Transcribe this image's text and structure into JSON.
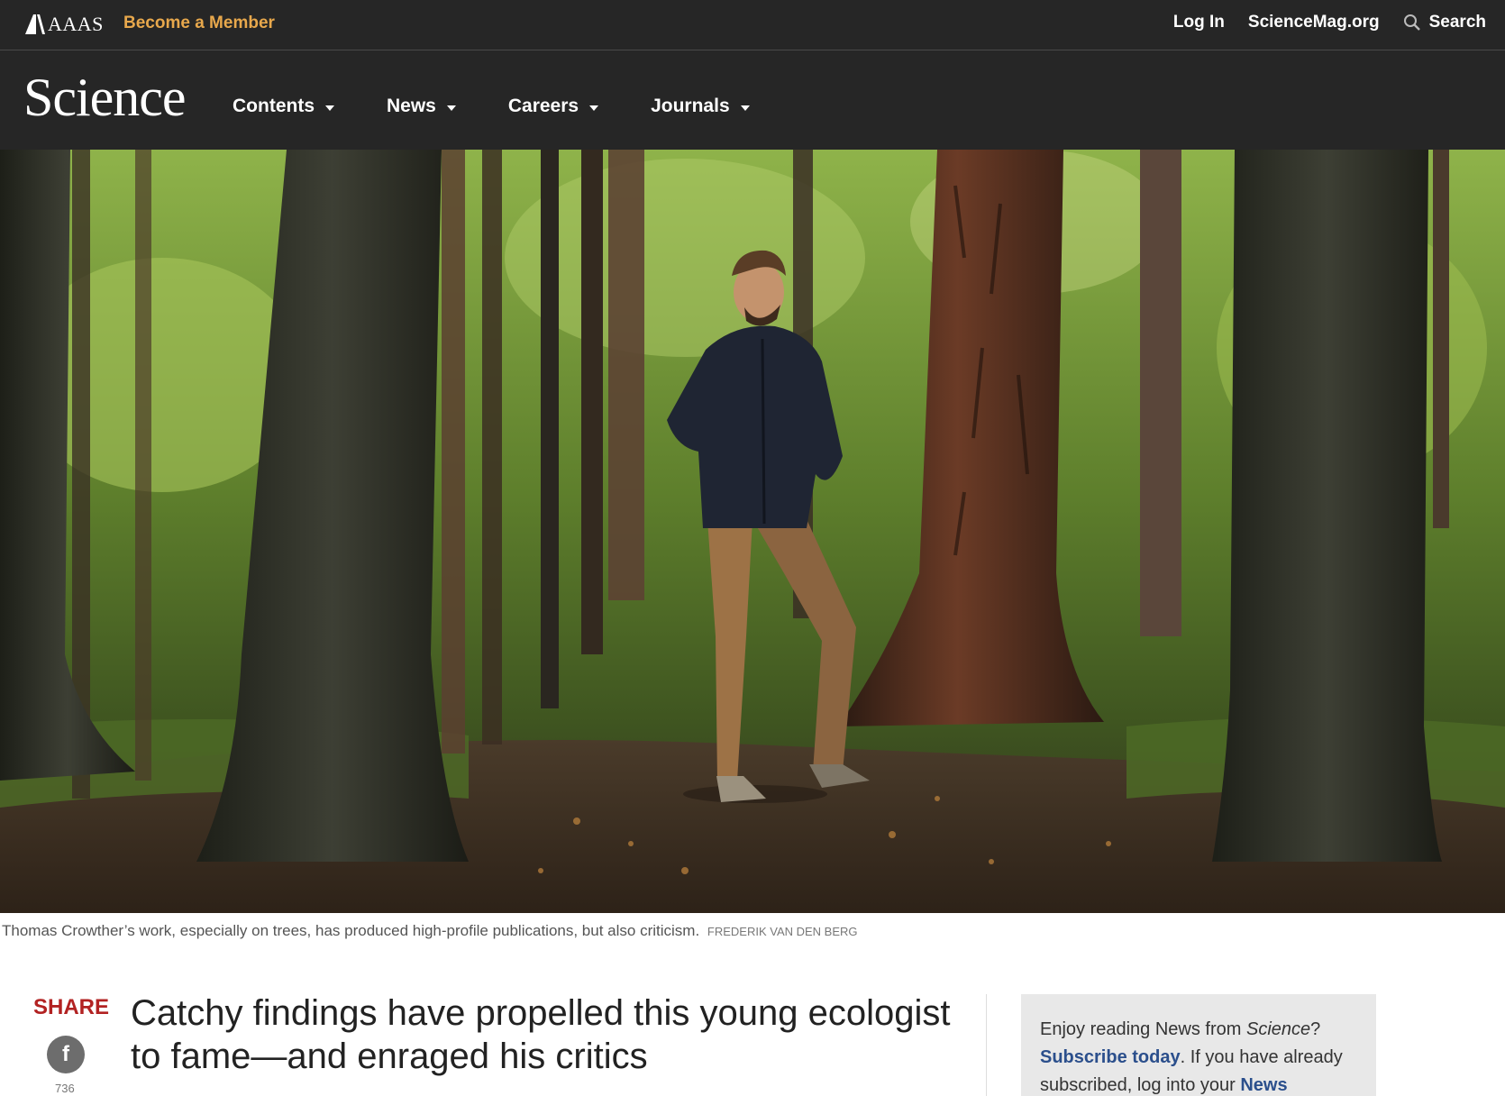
{
  "topbar": {
    "brand": "AAAS",
    "become_member": "Become a Member",
    "login": "Log In",
    "sciencemag": "ScienceMag.org",
    "search": "Search"
  },
  "nav": {
    "logo": "Science",
    "items": [
      {
        "label": "Contents"
      },
      {
        "label": "News"
      },
      {
        "label": "Careers"
      },
      {
        "label": "Journals"
      }
    ]
  },
  "photo": {
    "caption": "Thomas Crowther’s work, especially on trees, has produced high-profile publications, but also criticism.",
    "credit": "FREDERIK VAN DEN BERG"
  },
  "share": {
    "label": "SHARE",
    "facebook_count": "736"
  },
  "article": {
    "headline": "Catchy findings have propelled this young ecologist to fame—and enraged his critics"
  },
  "promo": {
    "line1_prefix": "Enjoy reading News from ",
    "line1_em": "Science",
    "line1_suffix": "?",
    "subscribe": "Subscribe today",
    "line2": ". If you have already subscribed, log into your ",
    "news_link": "News"
  },
  "colors": {
    "bar_bg": "#262626",
    "member_accent": "#e8a84c",
    "share_red": "#b22222",
    "link_blue": "#2b4f8c"
  }
}
